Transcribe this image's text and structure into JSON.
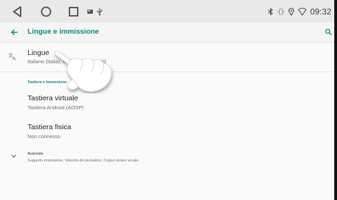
{
  "status_bar": {
    "clock": "09:32",
    "nav_icons": [
      "back-triangle-icon",
      "home-circle-icon",
      "recents-square-icon"
    ],
    "notification_icons": [
      "image-icon",
      "usb-icon"
    ],
    "status_icons": [
      "bluetooth-icon",
      "vibrate-icon",
      "location-icon",
      "wifi-icon"
    ]
  },
  "app_bar": {
    "title": "Lingue e immissione",
    "back_icon": "arrow-left-icon",
    "search_icon": "search-icon"
  },
  "list": {
    "languages": {
      "title": "Lingue",
      "subtitle": "Italiano (Italia), Inglese (Stati Uniti)",
      "icon": "translate-icon"
    },
    "keyboards_header": "Tastiera e immissione",
    "virtual_keyboard": {
      "title": "Tastiera virtuale",
      "subtitle": "Tastiera Android (AOSP)"
    },
    "physical_keyboard": {
      "title": "Tastiera fisica",
      "subtitle": "Non connesso"
    },
    "advanced": {
      "title": "Avanzate",
      "subtitle": "Supporto immissione, Velocità del puntatore, Output sintesi vocale",
      "icon": "chevron-down-icon"
    }
  },
  "overlay": {
    "pointer_icon": "tap-hand-icon"
  },
  "colors": {
    "accent": "#0a8a7a",
    "status_bar_bg": "#e9e9e9",
    "background": "#fafafa"
  }
}
